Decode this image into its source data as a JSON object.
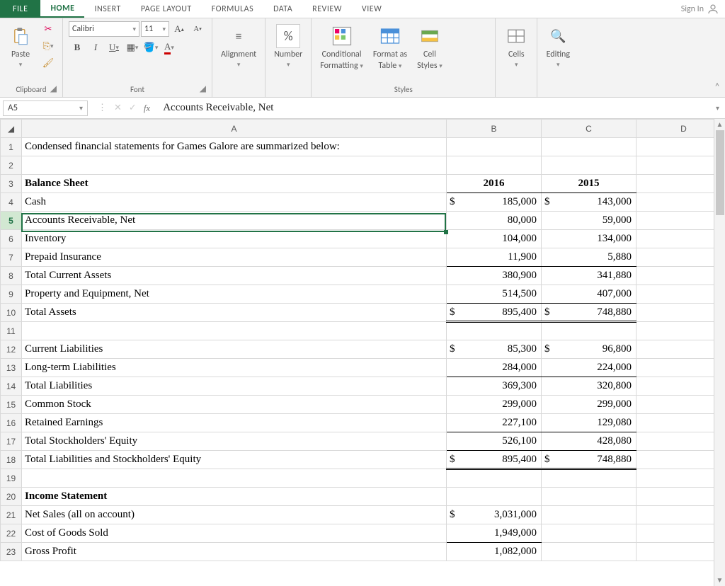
{
  "tabs": {
    "file": "FILE",
    "home": "HOME",
    "insert": "INSERT",
    "page_layout": "PAGE LAYOUT",
    "formulas": "FORMULAS",
    "data": "DATA",
    "review": "REVIEW",
    "view": "VIEW"
  },
  "sign_in": "Sign In",
  "ribbon": {
    "paste": "Paste",
    "clipboard": "Clipboard",
    "font_name": "Calibri",
    "font_size": "11",
    "font_group": "Font",
    "alignment": "Alignment",
    "number": "Number",
    "pct": "%",
    "cond_fmt_1": "Conditional",
    "cond_fmt_2": "Formatting",
    "fmt_table_1": "Format as",
    "fmt_table_2": "Table",
    "cell_styles_1": "Cell",
    "cell_styles_2": "Styles",
    "styles": "Styles",
    "cells": "Cells",
    "editing": "Editing"
  },
  "namebox": "A5",
  "formula": "Accounts Receivable, Net",
  "cols": {
    "a": "A",
    "b": "B",
    "c": "C",
    "d": "D"
  },
  "rows": [
    {
      "n": "1",
      "a": "Condensed financial statements for Games Galore are summarized below:",
      "b": "",
      "bc": "",
      "c": "",
      "cc": "",
      "style": ""
    },
    {
      "n": "2",
      "a": "",
      "b": "",
      "bc": "",
      "c": "",
      "cc": "",
      "style": ""
    },
    {
      "n": "3",
      "a": "Balance Sheet",
      "b": "2016",
      "bc": "",
      "c": "2015",
      "cc": "",
      "style": "bold",
      "b_style": "bold under-b center",
      "c_style": "bold under-b center"
    },
    {
      "n": "4",
      "a": "Cash",
      "b": "185,000",
      "bc": "$",
      "c": "143,000",
      "cc": "$",
      "style": ""
    },
    {
      "n": "5",
      "a": "Accounts Receivable, Net",
      "b": "80,000",
      "bc": "",
      "c": "59,000",
      "cc": "",
      "style": ""
    },
    {
      "n": "6",
      "a": "Inventory",
      "b": "104,000",
      "bc": "",
      "c": "134,000",
      "cc": "",
      "style": ""
    },
    {
      "n": "7",
      "a": "Prepaid Insurance",
      "b": "11,900",
      "bc": "",
      "c": "5,880",
      "cc": "",
      "style": "",
      "b_style": "under-b",
      "c_style": "under-b"
    },
    {
      "n": "8",
      "a": "Total Current Assets",
      "b": "380,900",
      "bc": "",
      "c": "341,880",
      "cc": "",
      "style": "indent1"
    },
    {
      "n": "9",
      "a": "Property and Equipment, Net",
      "b": "514,500",
      "bc": "",
      "c": "407,000",
      "cc": "",
      "style": "",
      "b_style": "under-b",
      "c_style": "under-b"
    },
    {
      "n": "10",
      "a": "Total Assets",
      "b": "895,400",
      "bc": "$",
      "c": "748,880",
      "cc": "$",
      "style": "indent1",
      "b_style": "dbl-b",
      "c_style": "dbl-b"
    },
    {
      "n": "11",
      "a": "",
      "b": "",
      "bc": "",
      "c": "",
      "cc": "",
      "style": ""
    },
    {
      "n": "12",
      "a": "Current Liabilities",
      "b": "85,300",
      "bc": "$",
      "c": "96,800",
      "cc": "$",
      "style": ""
    },
    {
      "n": "13",
      "a": "Long-term Liabilities",
      "b": "284,000",
      "bc": "",
      "c": "224,000",
      "cc": "",
      "style": "",
      "b_style": "under-b",
      "c_style": "under-b"
    },
    {
      "n": "14",
      "a": "Total Liabilities",
      "b": "369,300",
      "bc": "",
      "c": "320,800",
      "cc": "",
      "style": "indent1"
    },
    {
      "n": "15",
      "a": "Common Stock",
      "b": "299,000",
      "bc": "",
      "c": "299,000",
      "cc": "",
      "style": ""
    },
    {
      "n": "16",
      "a": "Retained Earnings",
      "b": "227,100",
      "bc": "",
      "c": "129,080",
      "cc": "",
      "style": "",
      "b_style": "under-b",
      "c_style": "under-b"
    },
    {
      "n": "17",
      "a": "Total Stockholders' Equity",
      "b": "526,100",
      "bc": "",
      "c": "428,080",
      "cc": "",
      "style": "indent1",
      "b_style": "under-b",
      "c_style": "under-b"
    },
    {
      "n": "18",
      "a": "Total Liabilities and Stockholders' Equity",
      "b": "895,400",
      "bc": "$",
      "c": "748,880",
      "cc": "$",
      "style": "indent1",
      "b_style": "dbl-b",
      "c_style": "dbl-b"
    },
    {
      "n": "19",
      "a": "",
      "b": "",
      "bc": "",
      "c": "",
      "cc": "",
      "style": ""
    },
    {
      "n": "20",
      "a": "Income Statement",
      "b": "",
      "bc": "",
      "c": "",
      "cc": "",
      "style": "bold"
    },
    {
      "n": "21",
      "a": "Net Sales (all on account)",
      "b": "3,031,000",
      "bc": "$",
      "c": "",
      "cc": "",
      "style": ""
    },
    {
      "n": "22",
      "a": "Cost of Goods Sold",
      "b": "1,949,000",
      "bc": "",
      "c": "",
      "cc": "",
      "style": "",
      "b_style": "under-b"
    },
    {
      "n": "23",
      "a": "Gross Profit",
      "b": "1,082,000",
      "bc": "",
      "c": "",
      "cc": "",
      "style": ""
    }
  ],
  "selected_row": 5
}
